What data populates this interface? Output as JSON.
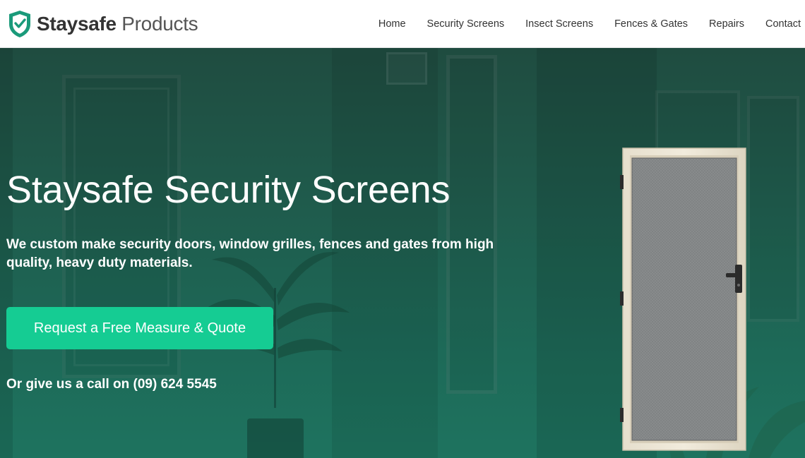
{
  "brand": {
    "name_strong": "Staysafe",
    "name_light": "Products",
    "logo_icon": "shield-icon",
    "logo_color": "#1a9a7a"
  },
  "nav": {
    "items": [
      {
        "label": "Home"
      },
      {
        "label": "Security Screens"
      },
      {
        "label": "Insect Screens"
      },
      {
        "label": "Fences & Gates"
      },
      {
        "label": "Repairs"
      },
      {
        "label": "Contact"
      }
    ]
  },
  "hero": {
    "title": "Staysafe Security Screens",
    "text": "We custom make security doors, window grilles, fences and gates from high quality, heavy duty materials.",
    "cta_label": "Request a Free Measure & Quote",
    "cta_color": "#15cc93",
    "call_prefix": "Or give us a call on",
    "phone": "(09) 624 5545",
    "image": "security-door-image"
  }
}
